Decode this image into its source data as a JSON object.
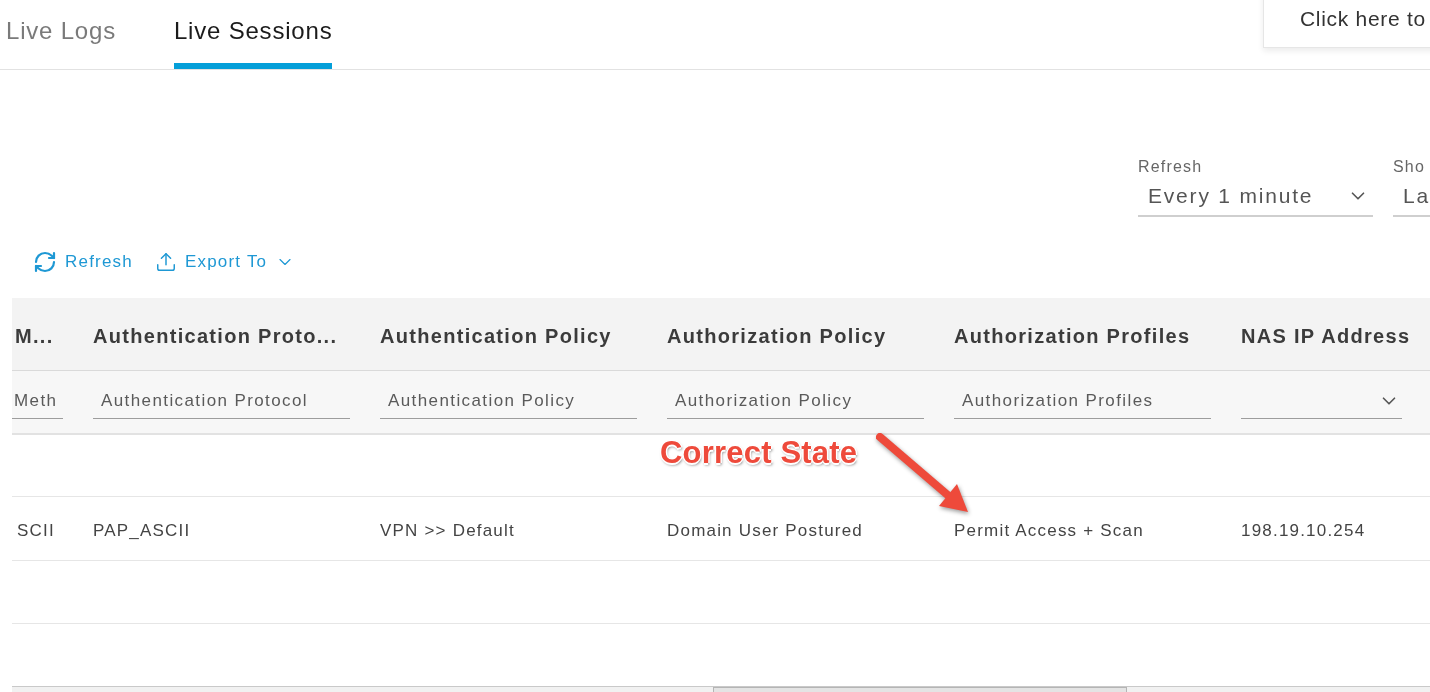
{
  "tabs": [
    {
      "label": "Live Logs",
      "selected": false
    },
    {
      "label": "Live Sessions",
      "selected": true
    }
  ],
  "notification": {
    "text": "Click here to"
  },
  "selectors": [
    {
      "label": "Refresh",
      "value": "Every 1 minute",
      "caret": true
    },
    {
      "label": "Sho",
      "value": "La"
    }
  ],
  "toolbar": [
    {
      "kind": "refresh",
      "label": "Refresh",
      "menu": false
    },
    {
      "kind": "export",
      "label": "Export To",
      "menu": true
    }
  ],
  "table": {
    "columns": [
      {
        "header": "M...",
        "filter": {
          "kind": "text",
          "placeholder": "Meth"
        }
      },
      {
        "header": "Authentication Proto...",
        "filter": {
          "kind": "text",
          "placeholder": "Authentication Protocol"
        }
      },
      {
        "header": "Authentication Policy",
        "filter": {
          "kind": "text",
          "placeholder": "Authentication Policy"
        }
      },
      {
        "header": "Authorization Policy",
        "filter": {
          "kind": "text",
          "placeholder": "Authorization Policy"
        }
      },
      {
        "header": "Authorization Profiles",
        "filter": {
          "kind": "text",
          "placeholder": "Authorization Profiles"
        }
      },
      {
        "header": "NAS IP Address",
        "filter": {
          "kind": "select"
        }
      }
    ],
    "rows": [
      {
        "cells": [
          "SCII",
          "PAP_ASCII",
          "VPN >> Default",
          "Domain User Postured",
          "Permit Access + Scan",
          "198.19.10.254"
        ]
      }
    ]
  },
  "annotation": {
    "text": "Correct State"
  }
}
